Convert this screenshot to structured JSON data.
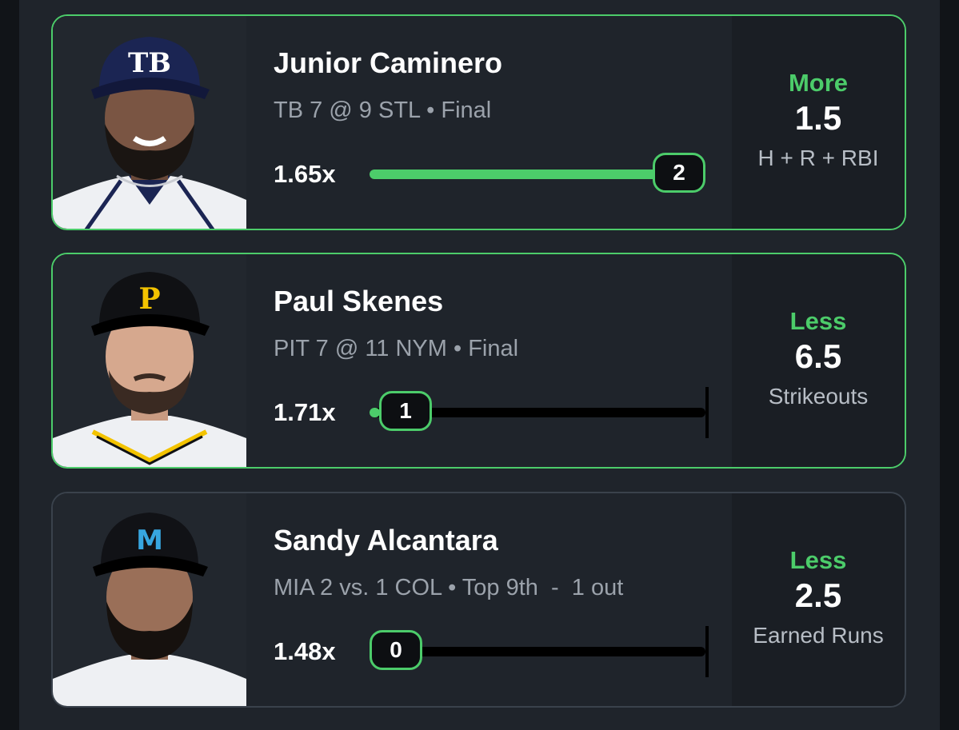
{
  "picks": [
    {
      "player_name": "Junior Caminero",
      "game_status": "TB 7 @ 9 STL • Final",
      "multiplier": "1.65x",
      "current_value": "2",
      "progress_fraction": 1.0,
      "direction": "More",
      "line": "1.5",
      "stat_type": "H + R + RBI",
      "team_logo_text": "TB",
      "cap_color": "#1b2553",
      "logo_color": "#ffffff"
    },
    {
      "player_name": "Paul Skenes",
      "game_status": "PIT 7 @ 11 NYM • Final",
      "multiplier": "1.71x",
      "current_value": "1",
      "progress_fraction": 0.03,
      "direction": "Less",
      "line": "6.5",
      "stat_type": "Strikeouts",
      "team_logo_text": "P",
      "cap_color": "#101114",
      "logo_color": "#f3c300"
    },
    {
      "player_name": "Sandy Alcantara",
      "game_status": "MIA 2 vs. 1 COL • Top 9th  -  1 out",
      "multiplier": "1.48x",
      "current_value": "0",
      "progress_fraction": 0.0,
      "direction": "Less",
      "line": "2.5",
      "stat_type": "Earned Runs",
      "team_logo_text": "M",
      "cap_color": "#111216",
      "logo_color": "#37a6e0"
    }
  ],
  "colors": {
    "accent": "#4ccc6a",
    "background": "#16191e",
    "card": "#1f242b"
  }
}
